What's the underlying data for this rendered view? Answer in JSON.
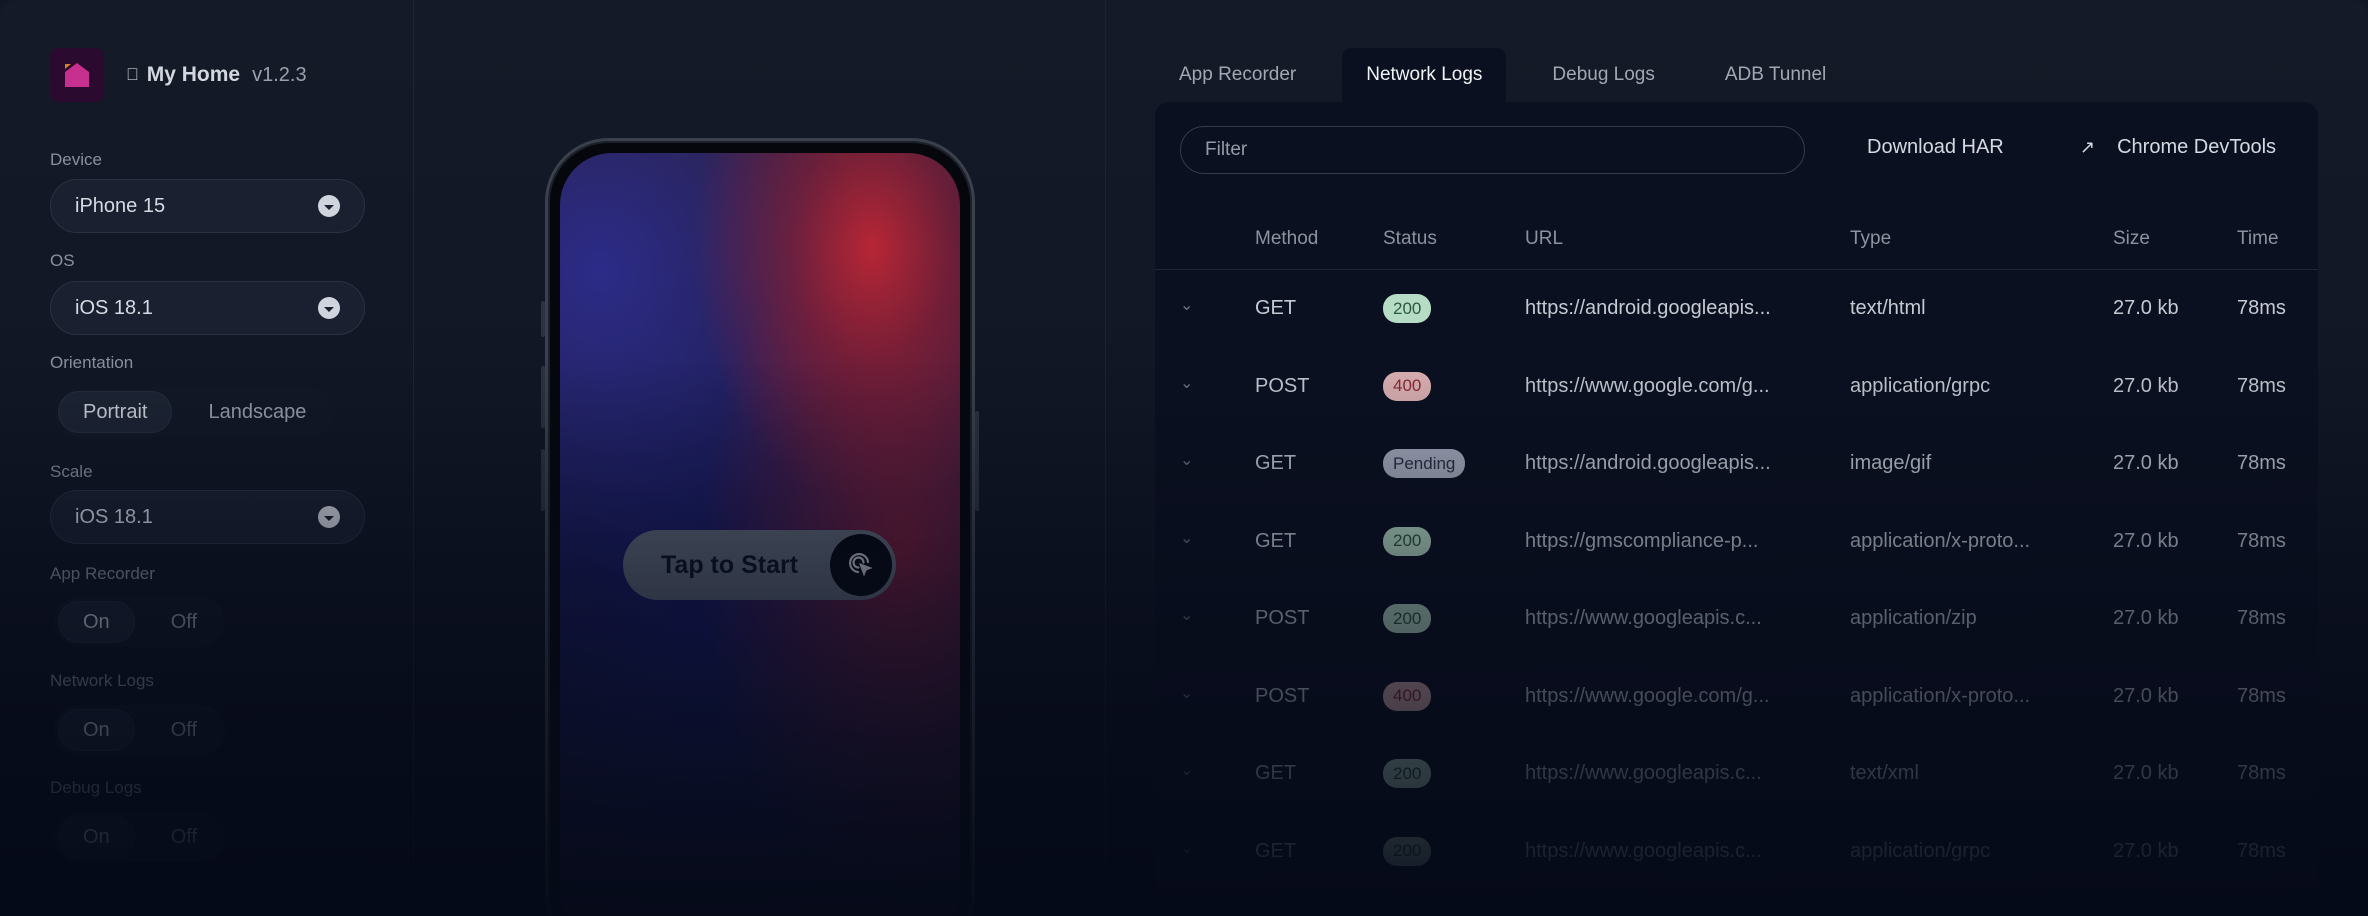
{
  "app": {
    "name": "My Home",
    "version": "v1.2.3",
    "platform_icon": "apple-icon",
    "logo_icon": "home-icon"
  },
  "sidebar": {
    "device": {
      "label": "Device",
      "value": "iPhone 15"
    },
    "os": {
      "label": "OS",
      "value": "iOS 18.1"
    },
    "orientation": {
      "label": "Orientation",
      "options": [
        "Portrait",
        "Landscape"
      ],
      "selected": "Portrait"
    },
    "scale": {
      "label": "Scale",
      "value": "iOS 18.1"
    },
    "app_recorder": {
      "label": "App Recorder",
      "options": [
        "On",
        "Off"
      ],
      "selected": "On"
    },
    "network_logs": {
      "label": "Network Logs",
      "options": [
        "On",
        "Off"
      ],
      "selected": "On"
    },
    "debug_logs": {
      "label": "Debug Logs",
      "options": [
        "On",
        "Off"
      ],
      "selected": "On"
    }
  },
  "preview": {
    "tap_label": "Tap to Start",
    "tap_icon": "tap-cursor-icon"
  },
  "tabs": [
    {
      "label": "App Recorder",
      "active": false
    },
    {
      "label": "Network Logs",
      "active": true
    },
    {
      "label": "Debug Logs",
      "active": false
    },
    {
      "label": "ADB Tunnel",
      "active": false
    }
  ],
  "network": {
    "filter_placeholder": "Filter",
    "filter_value": "",
    "download_label": "Download HAR",
    "devtools_label": "Chrome DevTools",
    "devtools_icon": "external-link-arrow-icon",
    "columns": [
      "Method",
      "Status",
      "URL",
      "Type",
      "Size",
      "Time"
    ],
    "rows": [
      {
        "method": "GET",
        "status": "200",
        "status_kind": "ok",
        "url": "https://android.googleapis...",
        "type": "text/html",
        "size": "27.0 kb",
        "time": "78ms"
      },
      {
        "method": "POST",
        "status": "400",
        "status_kind": "err",
        "url": "https://www.google.com/g...",
        "type": "application/grpc",
        "size": "27.0 kb",
        "time": "78ms"
      },
      {
        "method": "GET",
        "status": "Pending",
        "status_kind": "pending",
        "url": "https://android.googleapis...",
        "type": "image/gif",
        "size": "27.0 kb",
        "time": "78ms"
      },
      {
        "method": "GET",
        "status": "200",
        "status_kind": "ok",
        "url": "https://gmscompliance-p...",
        "type": "application/x-proto...",
        "size": "27.0 kb",
        "time": "78ms"
      },
      {
        "method": "POST",
        "status": "200",
        "status_kind": "ok",
        "url": "https://www.googleapis.c...",
        "type": "application/zip",
        "size": "27.0 kb",
        "time": "78ms"
      },
      {
        "method": "POST",
        "status": "400",
        "status_kind": "err",
        "url": "https://www.google.com/g...",
        "type": "application/x-proto...",
        "size": "27.0 kb",
        "time": "78ms"
      },
      {
        "method": "GET",
        "status": "200",
        "status_kind": "ok",
        "url": "https://www.googleapis.c...",
        "type": "text/xml",
        "size": "27.0 kb",
        "time": "78ms"
      },
      {
        "method": "GET",
        "status": "200",
        "status_kind": "ok",
        "url": "https://www.googleapis.c...",
        "type": "application/grpc",
        "size": "27.0 kb",
        "time": "78ms"
      }
    ]
  },
  "colors": {
    "background": "#121826",
    "panel": "#0b1020",
    "logo_bg": "#2a0a2e",
    "logo_house": "#c8308f",
    "logo_accent": "#d0822e",
    "status_ok": "#b7dcc5",
    "status_err": "#dcb1b4",
    "status_pending": "#a9afc0"
  }
}
